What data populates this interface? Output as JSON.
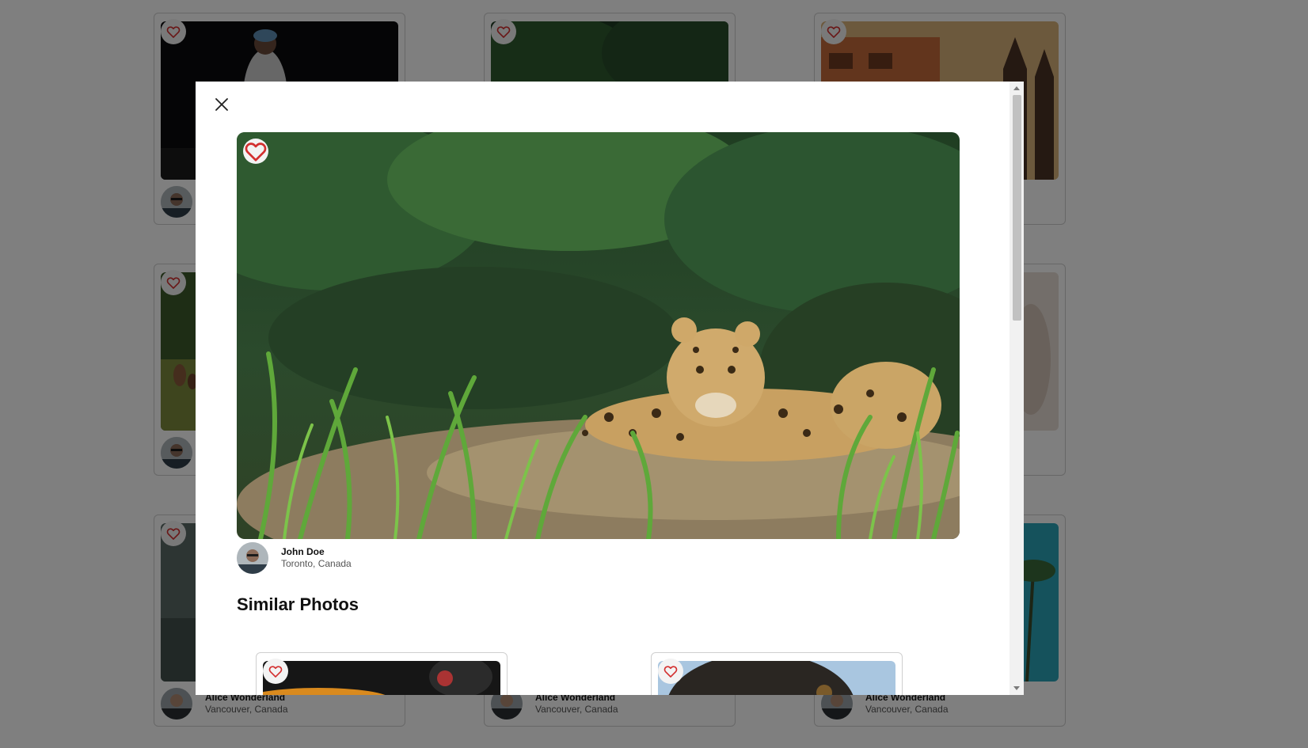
{
  "colors": {
    "overlay": "rgba(0,0,0,0.5)",
    "heart": "#d32f2f",
    "card_border": "#cfcfcf",
    "modal_bg": "#ffffff"
  },
  "background_cards": [
    {
      "author": "",
      "location": "",
      "icon": "heart-outline-icon"
    },
    {
      "author": "",
      "location": "",
      "icon": "heart-outline-icon"
    },
    {
      "author": "",
      "location": "",
      "icon": "heart-outline-icon"
    },
    {
      "author": "",
      "location": "",
      "icon": "heart-outline-icon"
    },
    {
      "author": "",
      "location": "",
      "icon": "heart-outline-icon"
    },
    {
      "author": "",
      "location": "",
      "icon": "heart-outline-icon"
    },
    {
      "author": "Alice Wonderland",
      "location": "Vancouver, Canada",
      "icon": "heart-outline-icon"
    },
    {
      "author": "Alice Wonderland",
      "location": "Vancouver, Canada",
      "icon": "heart-outline-icon"
    },
    {
      "author": "Alice Wonderland",
      "location": "Vancouver, Canada",
      "icon": "heart-outline-icon"
    }
  ],
  "modal": {
    "close_icon": "close-icon",
    "photo": {
      "subject": "jaguar resting in tall grass",
      "icon": "heart-outline-icon"
    },
    "author": {
      "name": "John Doe",
      "location": "Toronto, Canada"
    },
    "similar_title": "Similar Photos",
    "similar_photos": [
      {
        "subject": "flower field",
        "icon": "heart-outline-icon"
      },
      {
        "subject": "dog close-up",
        "icon": "heart-outline-icon"
      }
    ]
  },
  "scrollbar": {
    "up_icon": "scroll-up-arrow-icon",
    "down_icon": "scroll-down-arrow-icon"
  }
}
